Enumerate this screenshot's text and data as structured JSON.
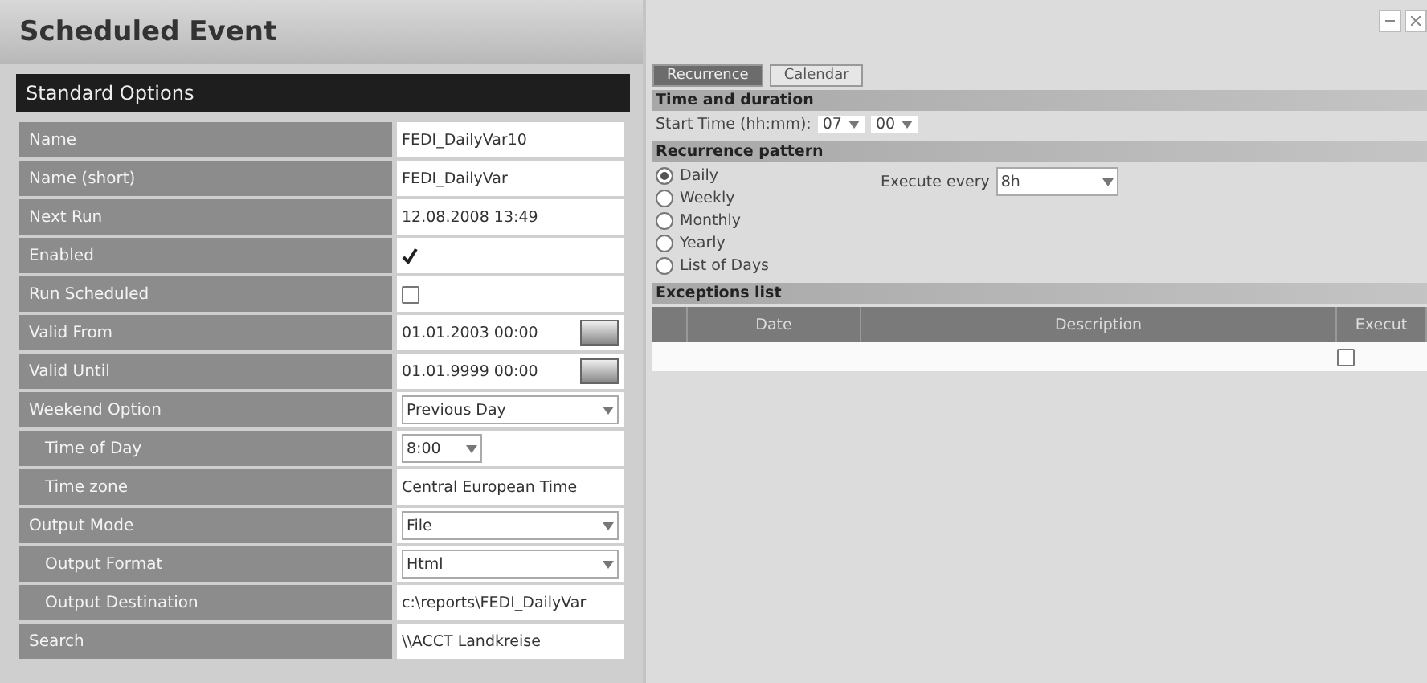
{
  "title": "Scheduled Event",
  "options": {
    "heading": "Standard Options",
    "rows": [
      {
        "label": "Name",
        "indent": false,
        "kind": "text",
        "value": "FEDI_DailyVar10"
      },
      {
        "label": "Name (short)",
        "indent": false,
        "kind": "text",
        "value": "FEDI_DailyVar"
      },
      {
        "label": "Next Run",
        "indent": false,
        "kind": "text",
        "value": "12.08.2008 13:49"
      },
      {
        "label": "Enabled",
        "indent": false,
        "kind": "tick",
        "checked": true
      },
      {
        "label": "Run Scheduled",
        "indent": false,
        "kind": "checkbox",
        "checked": false
      },
      {
        "label": "Valid From",
        "indent": false,
        "kind": "date",
        "value": "01.01.2003 00:00"
      },
      {
        "label": "Valid Until",
        "indent": false,
        "kind": "date",
        "value": "01.01.9999 00:00"
      },
      {
        "label": "Weekend Option",
        "indent": false,
        "kind": "select",
        "value": "Previous Day"
      },
      {
        "label": "Time of Day",
        "indent": true,
        "kind": "spin",
        "value": "8:00"
      },
      {
        "label": "Time zone",
        "indent": true,
        "kind": "text",
        "value": "Central European Time"
      },
      {
        "label": "Output Mode",
        "indent": false,
        "kind": "select",
        "value": "File"
      },
      {
        "label": "Output Format",
        "indent": true,
        "kind": "select",
        "value": "Html"
      },
      {
        "label": "Output Destination",
        "indent": true,
        "kind": "input",
        "value": "c:\\reports\\FEDI_DailyVar"
      },
      {
        "label": "Search",
        "indent": false,
        "kind": "text",
        "value": "\\\\ACCT Landkreise"
      }
    ]
  },
  "tabs": [
    {
      "label": "Recurrence",
      "selected": true
    },
    {
      "label": "Calendar",
      "selected": false
    }
  ],
  "time": {
    "heading": "Time and duration",
    "label": "Start Time (hh:mm):",
    "hours": "07",
    "minutes": "00"
  },
  "pattern": {
    "heading": "Recurrence pattern",
    "options": [
      {
        "label": "Daily",
        "selected": true
      },
      {
        "label": "Weekly",
        "selected": false
      },
      {
        "label": "Monthly",
        "selected": false
      },
      {
        "label": "Yearly",
        "selected": false
      },
      {
        "label": "List of Days",
        "selected": false
      }
    ],
    "every_label": "Execute every",
    "every_value": "8h"
  },
  "exceptions": {
    "heading": "Exceptions list",
    "columns": [
      "Date",
      "Description",
      "Execut"
    ],
    "rows": [
      {
        "date": "",
        "execute": false
      }
    ]
  }
}
